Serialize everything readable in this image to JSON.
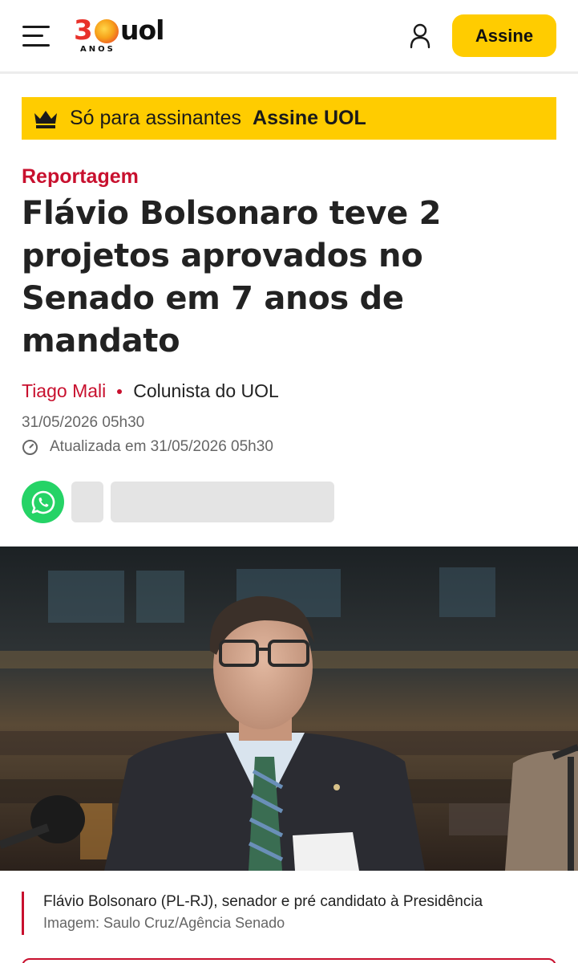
{
  "header": {
    "logo_number": "3",
    "logo_brand": "uol",
    "logo_anos": "ANOS",
    "subscribe_label": "Assine",
    "menu_icon": "hamburger-menu-icon",
    "user_icon": "user-icon"
  },
  "banner": {
    "icon": "crown-icon",
    "text": "Só para assinantes",
    "cta": "Assine UOL"
  },
  "article": {
    "kicker": "Reportagem",
    "title": "Flávio Bolsonaro teve 2 projetos aprovados no Senado em 7 anos de mandato",
    "author": "Tiago Mali",
    "author_role": "Colunista do UOL",
    "published": "31/05/2026 05h30",
    "updated": "Atualizada em 31/05/2026 05h30"
  },
  "share": {
    "whatsapp_icon": "whatsapp-icon"
  },
  "photo": {
    "caption": "Flávio Bolsonaro (PL-RJ), senador e pré candidato à Presidência",
    "credit": "Imagem: Saulo Cruz/Agência Senado"
  },
  "colors": {
    "brand_yellow": "#ffcc00",
    "accent_red": "#c8102e",
    "whatsapp_green": "#25d366"
  }
}
